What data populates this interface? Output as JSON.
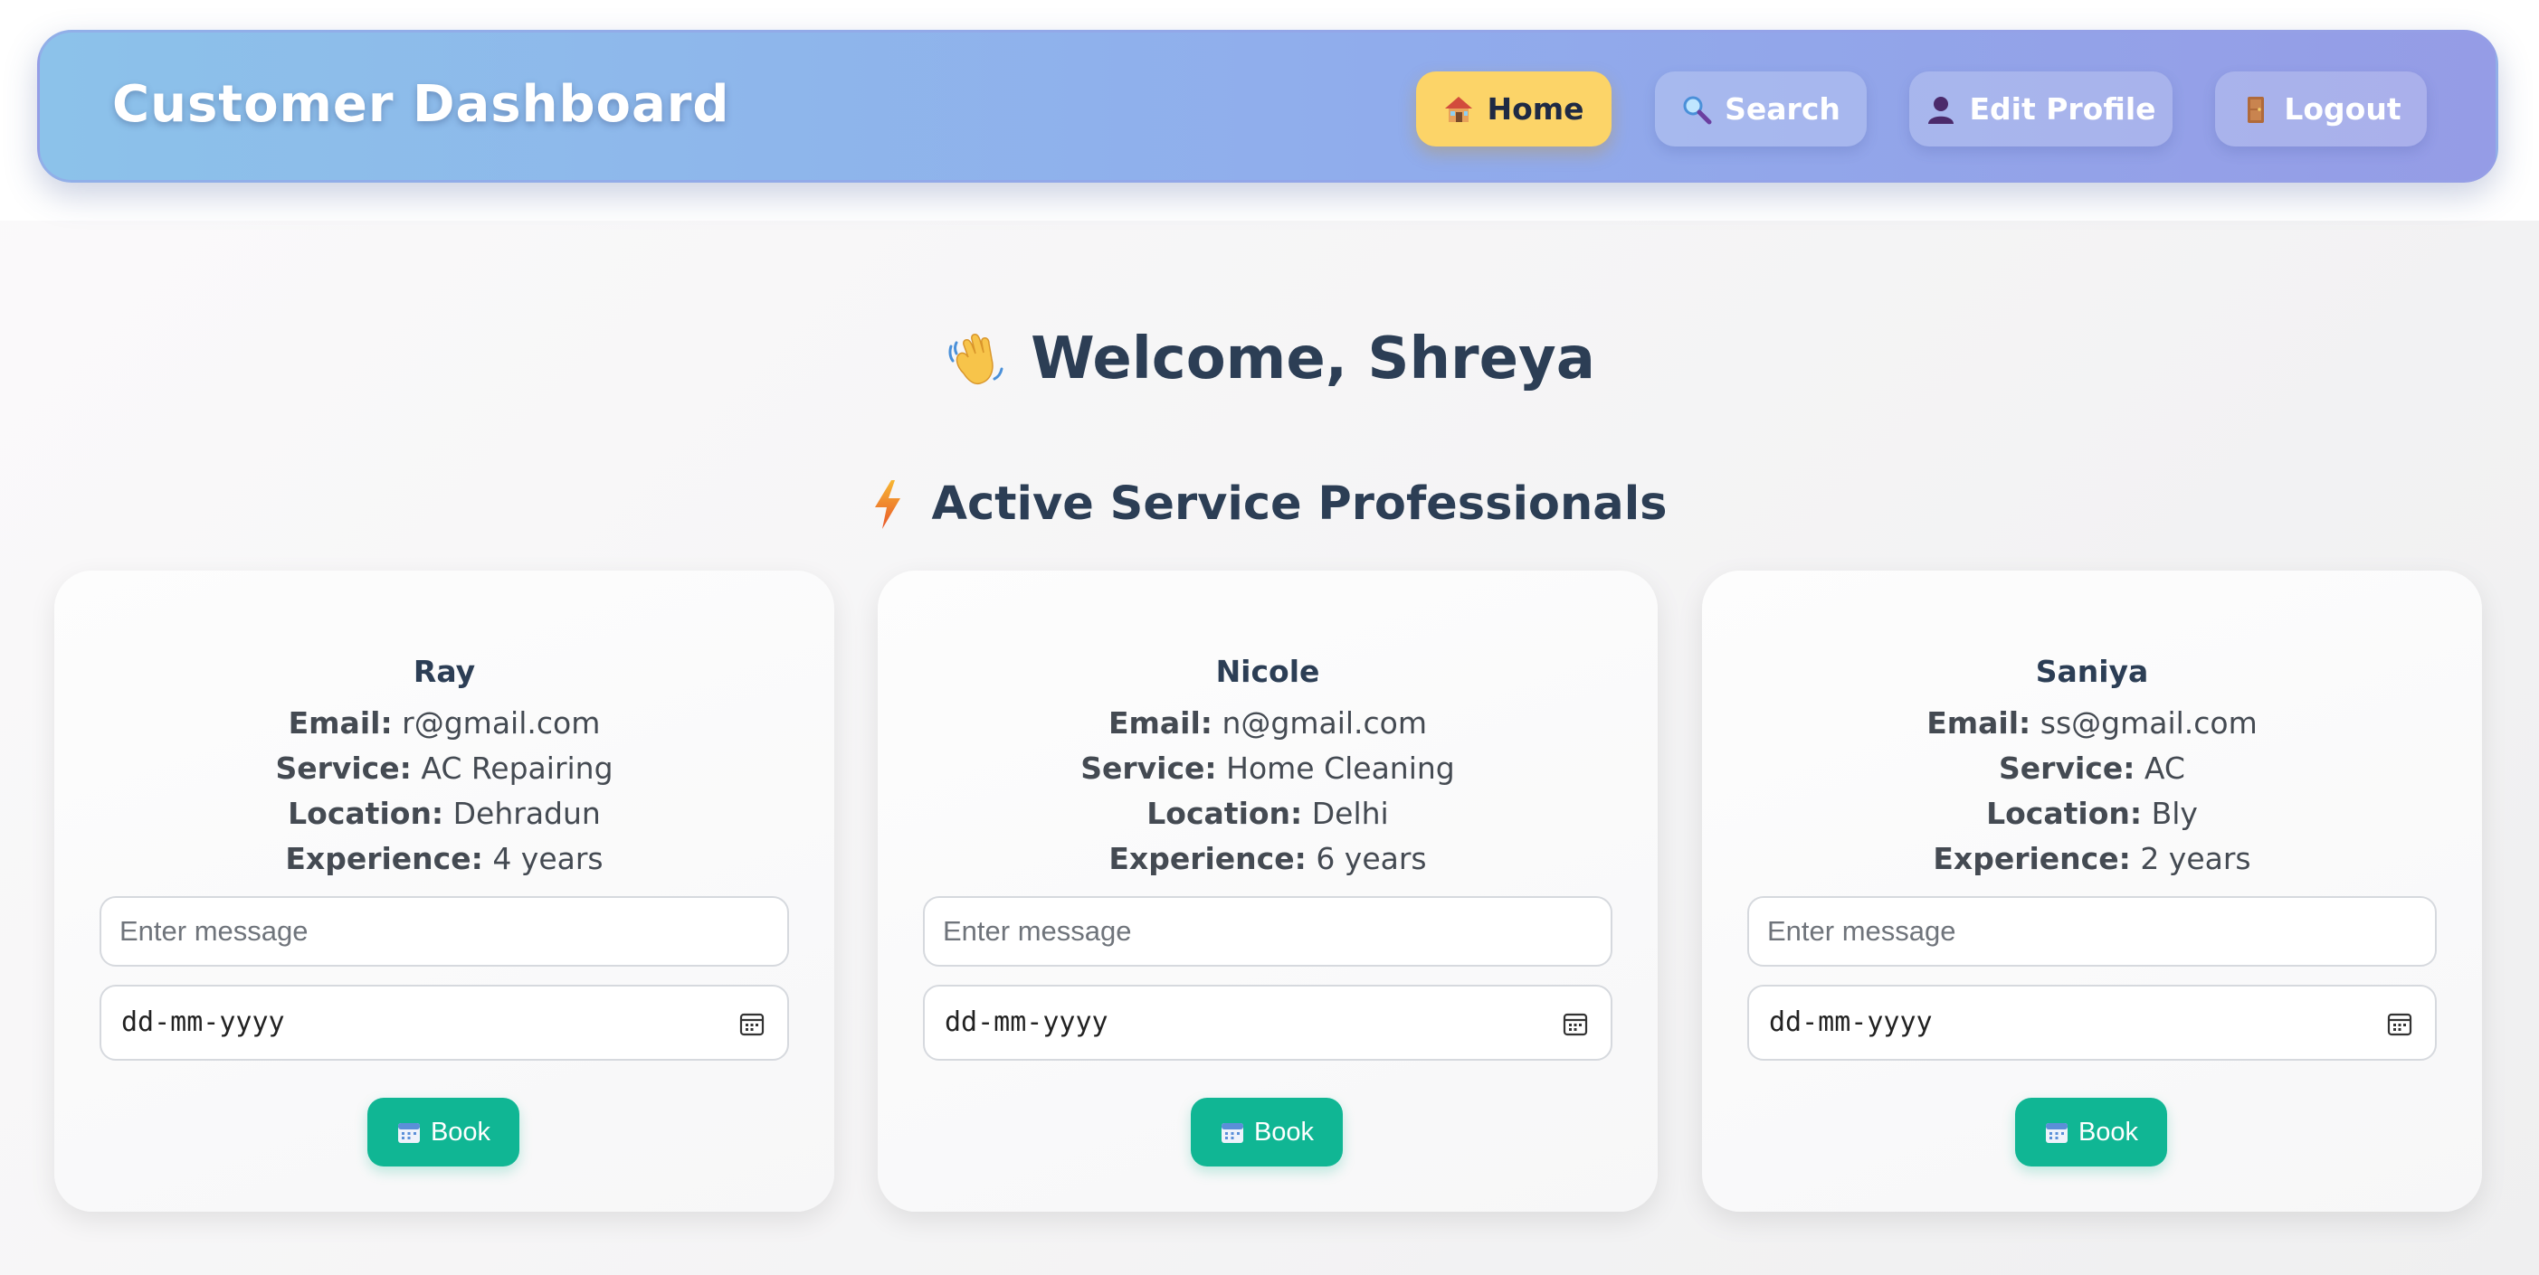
{
  "navbar": {
    "brand": "Customer Dashboard",
    "items": [
      {
        "label": "Home",
        "icon": "house-icon",
        "active": true
      },
      {
        "label": "Search",
        "icon": "magnifier-icon",
        "active": false
      },
      {
        "label": "Edit Profile",
        "icon": "person-icon",
        "active": false
      },
      {
        "label": "Logout",
        "icon": "door-icon",
        "active": false
      }
    ]
  },
  "main": {
    "welcome": "Welcome, Shreya",
    "welcome_icon": "waving-hand-icon",
    "section_title": "Active Service Professionals",
    "section_icon": "lightning-icon"
  },
  "labels": {
    "email": "Email:",
    "service": "Service:",
    "location": "Location:",
    "experience": "Experience:"
  },
  "professionals": [
    {
      "name": "Ray",
      "email": "r@gmail.com",
      "service": "AC Repairing",
      "location": "Dehradun",
      "experience": "4 years",
      "message_placeholder": "Enter message",
      "date_placeholder": "dd-mm-yyyy",
      "book_label": "Book"
    },
    {
      "name": "Nicole",
      "email": "n@gmail.com",
      "service": "Home Cleaning",
      "location": "Delhi",
      "experience": "6 years",
      "message_placeholder": "Enter message",
      "date_placeholder": "dd-mm-yyyy",
      "book_label": "Book"
    },
    {
      "name": "Saniya",
      "email": "ss@gmail.com",
      "service": "AC",
      "location": "Bly",
      "experience": "2 years",
      "message_placeholder": "Enter message",
      "date_placeholder": "dd-mm-yyyy",
      "book_label": "Book"
    }
  ],
  "colors": {
    "nav_gradient_start": "#8cc2ea",
    "nav_gradient_end": "#959ce6",
    "active_nav": "#fcd468",
    "book_button": "#10b694",
    "heading": "#2c3e55"
  }
}
